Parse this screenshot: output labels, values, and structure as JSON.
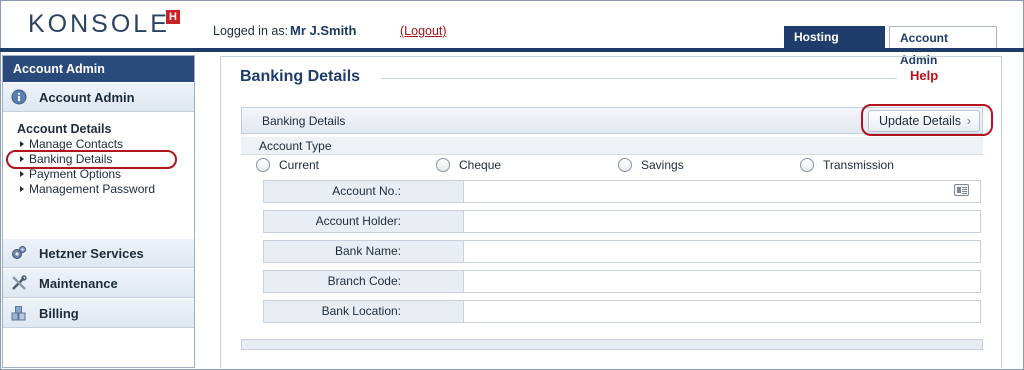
{
  "header": {
    "logo_text": "KONSOLE",
    "logo_badge": "H",
    "logged_in_label": "Logged in as:",
    "user_name": "Mr J.Smith",
    "logout_label": "(Logout)",
    "tabs": [
      {
        "label": "Hosting Services",
        "active": false
      },
      {
        "label": "Account Admin",
        "active": true
      }
    ]
  },
  "sidebar": {
    "header": "Account Admin",
    "sections": [
      {
        "label": "Account Admin",
        "icon": "info-icon"
      },
      {
        "label": "Hetzner Services",
        "icon": "gears-icon"
      },
      {
        "label": "Maintenance",
        "icon": "tools-icon"
      },
      {
        "label": "Billing",
        "icon": "blocks-icon"
      }
    ],
    "subsection_title": "Account Details",
    "links": [
      "Manage Contacts",
      "Banking Details",
      "Payment Options",
      "Management Password"
    ]
  },
  "main": {
    "title": "Banking Details",
    "help_label": "Help",
    "bar_label": "Banking Details",
    "update_button": "Update Details",
    "account_type_label": "Account Type",
    "account_types": [
      "Current",
      "Cheque",
      "Savings",
      "Transmission"
    ],
    "fields": [
      {
        "label": "Account No.:",
        "value": ""
      },
      {
        "label": "Account Holder:",
        "value": ""
      },
      {
        "label": "Bank Name:",
        "value": ""
      },
      {
        "label": "Branch Code:",
        "value": ""
      },
      {
        "label": "Bank Location:",
        "value": ""
      }
    ]
  },
  "colors": {
    "brand_navy": "#1f3d6b",
    "accent_red": "#b2131c"
  }
}
